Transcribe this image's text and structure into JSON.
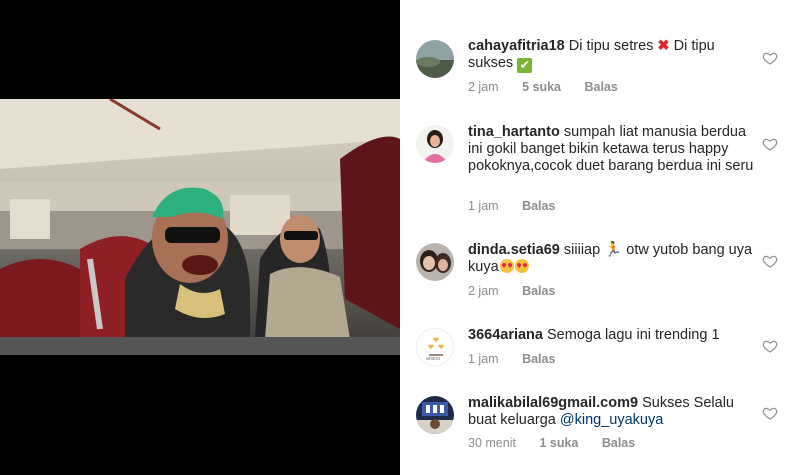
{
  "comments": [
    {
      "username": "cahayafitria18",
      "text_1": "Di tipu setres",
      "emoji_1": "✖",
      "text_2": "Di tipu sukses",
      "emoji_2": "✔",
      "time": "2 jam",
      "likes": "5 suka",
      "reply": "Balas"
    },
    {
      "username": "tina_hartanto",
      "text": "sumpah liat manusia berdua ini gokil banget bikin ketawa terus happy pokoknya,cocok duet barang berdua ini seru",
      "time": "1 jam",
      "reply": "Balas"
    },
    {
      "username": "dinda.setia69",
      "text_1": "siiiiap",
      "runner": "🏃",
      "text_2": "otw yutob bang uya kuya",
      "time": "2 jam",
      "reply": "Balas"
    },
    {
      "username": "3664ariana",
      "text": "Semoga lagu ini trending 1",
      "avatar_caption": "ariana",
      "time": "1 jam",
      "reply": "Balas"
    },
    {
      "username": "malikabilal69gmail.com9",
      "text": "Sukses Selalu buat keluarga",
      "mention": "@king_uyakuya",
      "time": "30 menit",
      "likes": "1 suka",
      "reply": "Balas"
    }
  ],
  "colors": {
    "text": "#262626",
    "meta": "#8e8e8e",
    "mention": "#00376b",
    "video_bg": "#000000"
  },
  "icons": {
    "like": "heart-outline-icon"
  }
}
